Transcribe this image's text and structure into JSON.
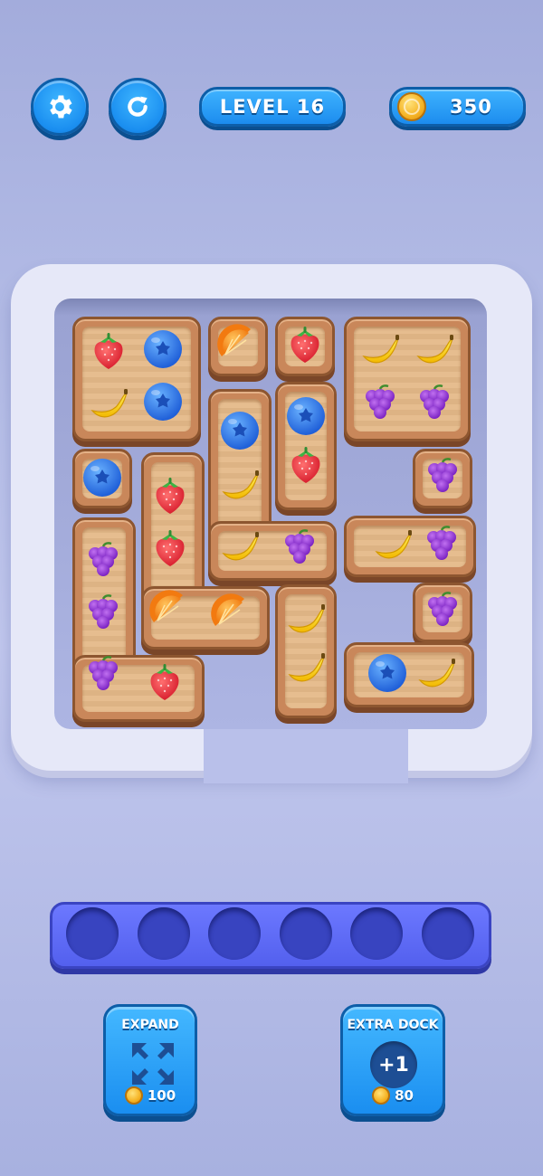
{
  "hud": {
    "settings_icon": "gear-icon",
    "restart_icon": "restart-icon",
    "level_label": "LEVEL 16",
    "coins": "350",
    "coin_icon": "coin-icon"
  },
  "board": {
    "fruit_types": [
      "strawberry",
      "blueberry",
      "banana",
      "orange",
      "grapes"
    ],
    "tiles": [
      {
        "id": "tile-1",
        "fruits": [
          "strawberry",
          "blueberry",
          "banana",
          "blueberry"
        ]
      },
      {
        "id": "tile-2",
        "fruits": [
          "orange"
        ]
      },
      {
        "id": "tile-3",
        "fruits": [
          "strawberry"
        ]
      },
      {
        "id": "tile-4",
        "fruits": [
          "banana",
          "banana",
          "grapes",
          "grapes"
        ]
      },
      {
        "id": "tile-5",
        "fruits": [
          "blueberry"
        ]
      },
      {
        "id": "tile-6",
        "fruits": [
          "blueberry",
          "banana",
          "banana",
          "grapes"
        ]
      },
      {
        "id": "tile-7",
        "fruits": [
          "blueberry",
          "strawberry"
        ]
      },
      {
        "id": "tile-8",
        "fruits": [
          "grapes"
        ]
      },
      {
        "id": "tile-9",
        "fruits": [
          "strawberry",
          "strawberry",
          "orange",
          "orange"
        ]
      },
      {
        "id": "tile-10",
        "fruits": [
          "banana",
          "grapes"
        ]
      },
      {
        "id": "tile-11",
        "fruits": [
          "grapes",
          "grapes",
          "grapes",
          "strawberry"
        ]
      },
      {
        "id": "tile-12",
        "fruits": [
          "banana",
          "banana"
        ]
      },
      {
        "id": "tile-13",
        "fruits": [
          "grapes"
        ]
      },
      {
        "id": "tile-14",
        "fruits": [
          "blueberry",
          "banana"
        ]
      }
    ]
  },
  "dock": {
    "slot_count": 6,
    "filled": 0
  },
  "powerups": {
    "expand": {
      "title": "EXPAND",
      "cost": "100",
      "icon": "expand-arrows-icon"
    },
    "extra_dock": {
      "title": "EXTRA DOCK",
      "cost": "80",
      "badge": "+1"
    }
  },
  "colors": {
    "button_blue": "#1a8ef0",
    "wood": "#c9875a",
    "dock": "#5360ee"
  }
}
